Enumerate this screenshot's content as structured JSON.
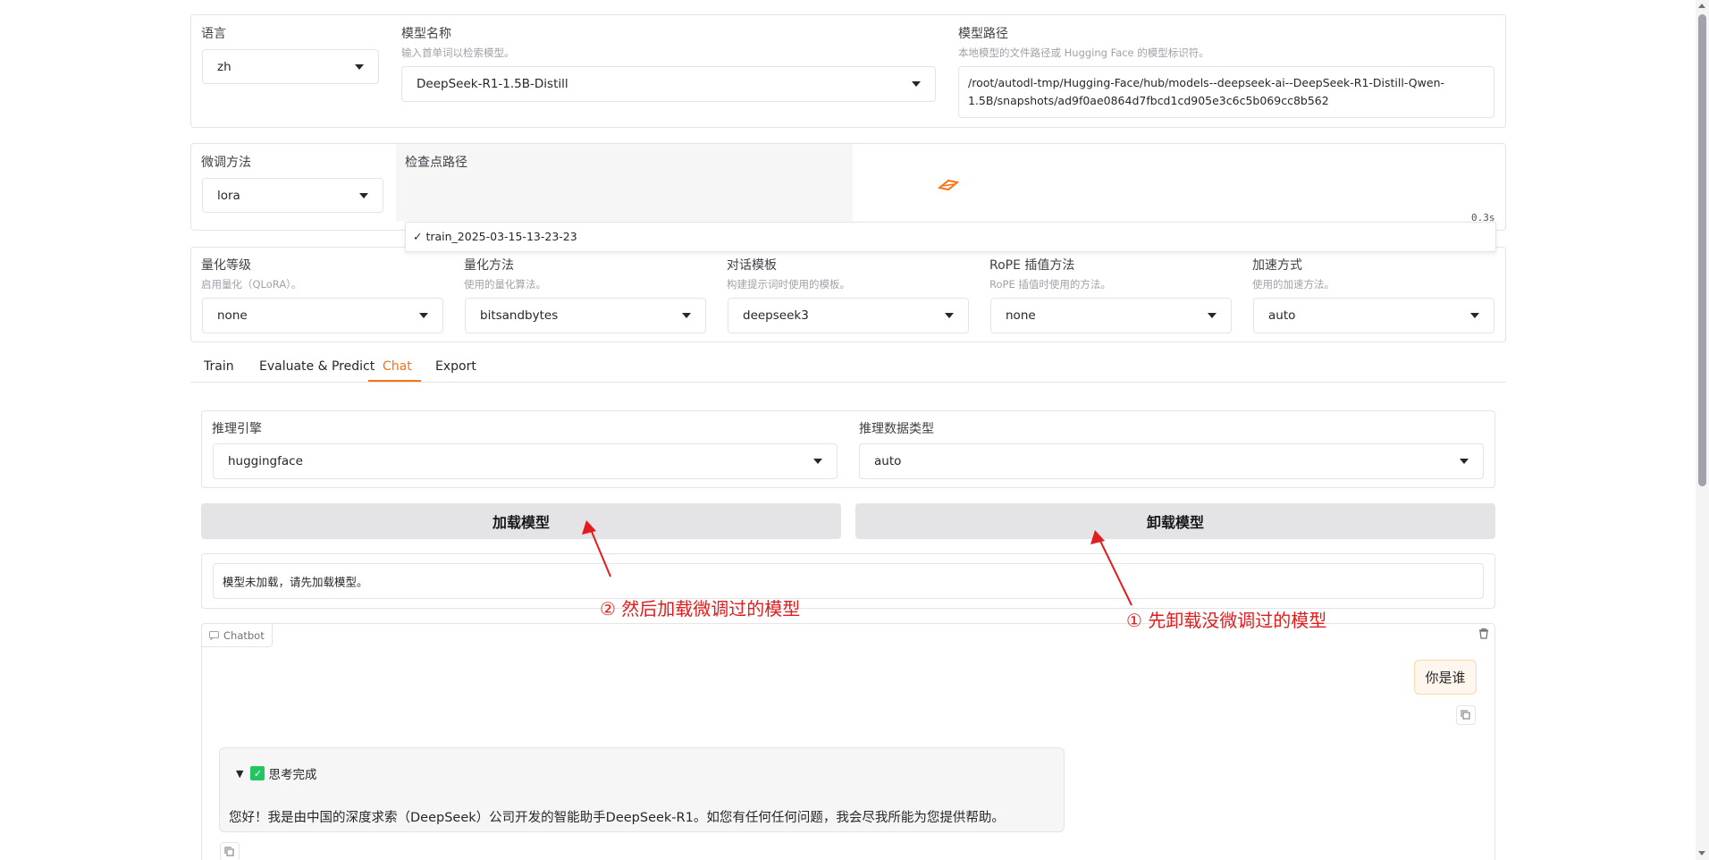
{
  "top": {
    "language": {
      "label": "语言",
      "value": "zh"
    },
    "model_name": {
      "label": "模型名称",
      "hint": "输入首单词以检索模型。",
      "value": "DeepSeek-R1-1.5B-Distill"
    },
    "model_path": {
      "label": "模型路径",
      "hint": "本地模型的文件路径或 Hugging Face 的模型标识符。",
      "line1": "/root/autodl-tmp/Hugging-Face/hub/models--deepseek-ai--DeepSeek-R1-Distill-Qwen-",
      "line2": "1.5B/snapshots/ad9f0ae0864d7fbcd1cd905e3c6c5b069cc8b562"
    }
  },
  "finetune": {
    "method": {
      "label": "微调方法",
      "value": "lora"
    },
    "checkpoint": {
      "label": "检查点路径",
      "timer": "0.3s",
      "option": "✓ train_2025-03-15-13-23-23"
    }
  },
  "advanced": {
    "quant_bit": {
      "label": "量化等级",
      "hint": "启用量化（QLoRA）。",
      "value": "none"
    },
    "quant_method": {
      "label": "量化方法",
      "hint": "使用的量化算法。",
      "value": "bitsandbytes"
    },
    "template": {
      "label": "对话模板",
      "hint": "构建提示词时使用的模板。",
      "value": "deepseek3"
    },
    "rope": {
      "label": "RoPE 插值方法",
      "hint": "RoPE 插值时使用的方法。",
      "value": "none"
    },
    "booster": {
      "label": "加速方式",
      "hint": "使用的加速方法。",
      "value": "auto"
    }
  },
  "tabs": [
    "Train",
    "Evaluate & Predict",
    "Chat",
    "Export"
  ],
  "chat": {
    "infer_backend": {
      "label": "推理引擎",
      "value": "huggingface"
    },
    "infer_dtype": {
      "label": "推理数据类型",
      "value": "auto"
    },
    "load_button": "加载模型",
    "unload_button": "卸载模型",
    "info": "模型未加载，请先加载模型。",
    "chatbot_label": "Chatbot",
    "user_message": "你是谁",
    "thinking_label": "思考完成",
    "thinking_marker": "▼",
    "check_emoji": "✓",
    "assistant_message": "您好！我是由中国的深度求索（DeepSeek）公司开发的智能助手DeepSeek-R1。如您有任何任何问题，我会尽我所能为您提供帮助。"
  },
  "annotations": {
    "step2": "② 然后加载微调过的模型",
    "step1": "① 先卸载没微调过的模型"
  },
  "colors": {
    "accent": "#f97316",
    "annotation": "#e11d1d",
    "user_bubble": "#fff7ed"
  }
}
